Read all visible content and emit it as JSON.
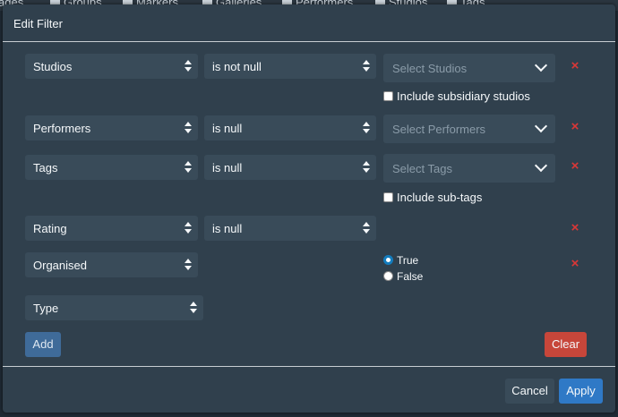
{
  "background_nav": {
    "items": [
      "ages",
      "Groups",
      "Markers",
      "Galleries",
      "Performers",
      "Studios",
      "Tags"
    ]
  },
  "modal": {
    "title": "Edit Filter"
  },
  "criteria": [
    {
      "field": "Studios",
      "modifier": "is not null",
      "value_placeholder": "Select Studios",
      "checkbox_label": "Include subsidiary studios"
    },
    {
      "field": "Performers",
      "modifier": "is null",
      "value_placeholder": "Select Performers"
    },
    {
      "field": "Tags",
      "modifier": "is null",
      "value_placeholder": "Select Tags",
      "checkbox_label": "Include sub-tags"
    },
    {
      "field": "Rating",
      "modifier": "is null"
    },
    {
      "field": "Organised",
      "options": [
        "True",
        "False"
      ],
      "selected": "True"
    }
  ],
  "new_criterion": {
    "field": "Type"
  },
  "remove_icon_glyph": "×",
  "buttons": {
    "add": "Add",
    "clear": "Clear",
    "cancel": "Cancel",
    "apply": "Apply"
  },
  "colors": {
    "modal_bg": "#30404d",
    "input_bg": "#394b59",
    "danger": "#db3737",
    "primary": "#2f79c6"
  }
}
